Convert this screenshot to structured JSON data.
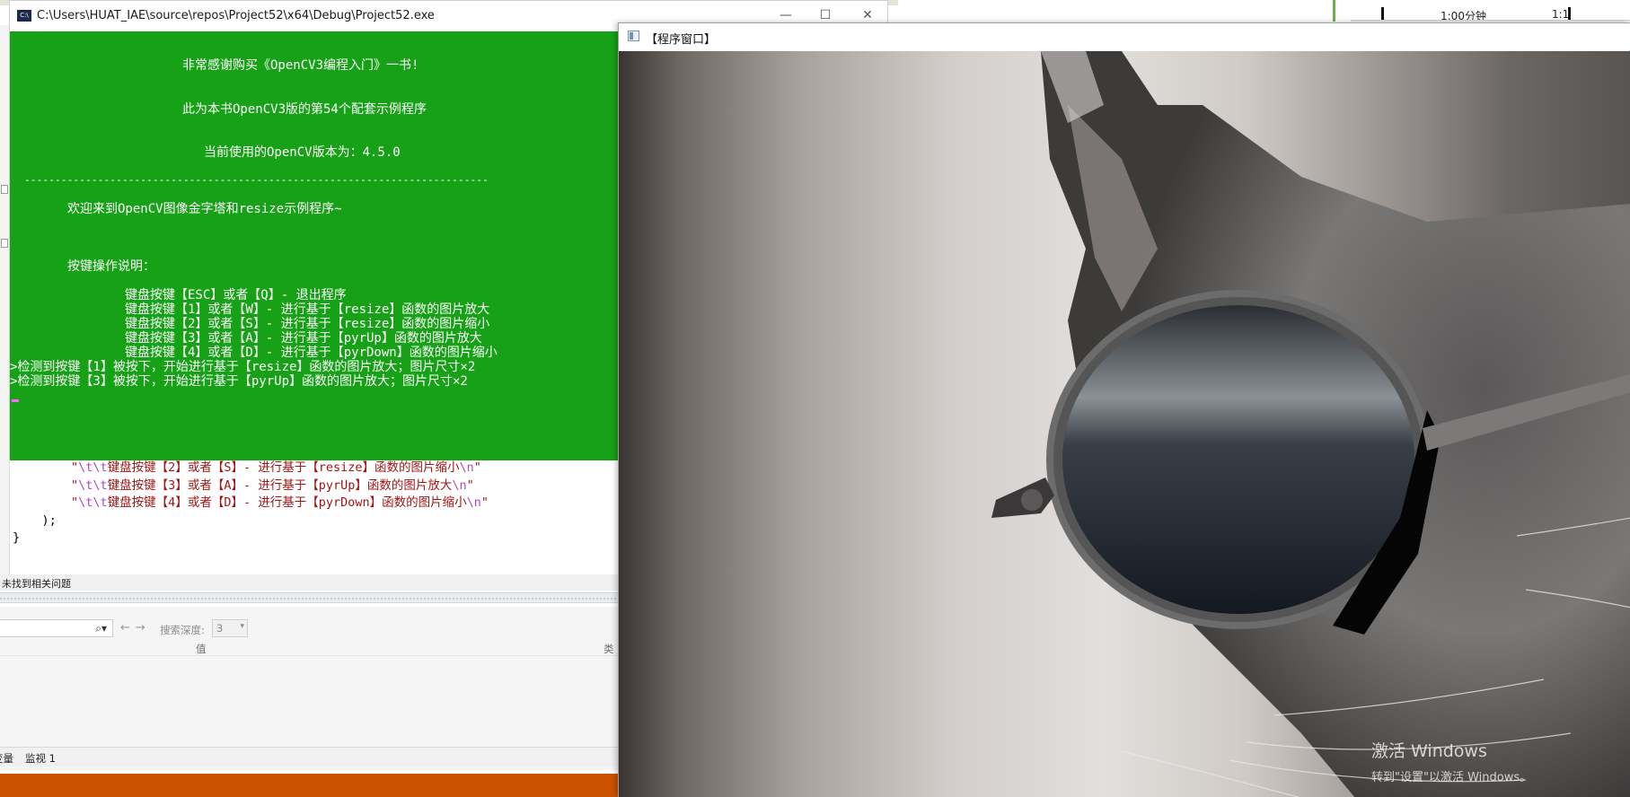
{
  "console": {
    "title": "C:\\Users\\HUAT_IAE\\source\\repos\\Project52\\x64\\Debug\\Project52.exe",
    "icon_text": "C:\\",
    "lines": [
      "非常感谢购买《OpenCV3编程入门》一书!",
      "此为本书OpenCV3版的第54个配套示例程序",
      "当前使用的OpenCV版本为：4.5.0",
      "----------------------------------------------------------------------------",
      "欢迎来到OpenCV图像金字塔和resize示例程序~",
      "按键操作说明：",
      "键盘按键【ESC】或者【Q】- 退出程序",
      "键盘按键【1】或者【W】- 进行基于【resize】函数的图片放大",
      "键盘按键【2】或者【S】- 进行基于【resize】函数的图片缩小",
      "键盘按键【3】或者【A】- 进行基于【pyrUp】函数的图片放大",
      "键盘按键【4】或者【D】- 进行基于【pyrDown】函数的图片缩小",
      ">检测到按键【1】被按下，开始进行基于【resize】函数的图片放大；图片尺寸×2",
      ">检测到按键【3】被按下，开始进行基于【pyrUp】函数的图片放大；图片尺寸×2"
    ],
    "buttons": {
      "minimize": "—",
      "maximize": "☐",
      "close": "✕"
    }
  },
  "editor": {
    "code_lines": [
      {
        "prefix": "\"",
        "esc1": "\\t\\t",
        "text": "键盘按键【2】或者【S】- 进行基于【resize】函数的图片缩小",
        "esc2": "\\n",
        "suffix": "\""
      },
      {
        "prefix": "\"",
        "esc1": "\\t\\t",
        "text": "键盘按键【3】或者【A】- 进行基于【pyrUp】函数的图片放大",
        "esc2": "\\n",
        "suffix": "\""
      },
      {
        "prefix": "\"",
        "esc1": "\\t\\t",
        "text": "键盘按键【4】或者【D】- 进行基于【pyrDown】函数的图片缩小",
        "esc2": "\\n",
        "suffix": "\""
      }
    ],
    "close_paren": ");",
    "close_brace": "}",
    "problem_status": "未找到相关问题"
  },
  "watch": {
    "search_placeholder": "",
    "search_icon": "⌕▾",
    "nav_arrows": "←→",
    "depth_label": "搜索深度:",
    "depth_value": "3",
    "col_value": "值",
    "col_type": "类",
    "tabs": [
      "变量",
      "监视 1"
    ]
  },
  "topright": {
    "time1": "1:00分钟",
    "time2": "1:1"
  },
  "image_window": {
    "title": "【程序窗口】",
    "watermark_line1": "激活 Windows",
    "watermark_line2": "转到\"设置\"以激活 Windows。"
  },
  "colors": {
    "console_bg": "#16a116",
    "console_fg": "#ffffff",
    "string": "#a31515",
    "escape": "#b146c2",
    "status_bar": "#ca5100"
  }
}
